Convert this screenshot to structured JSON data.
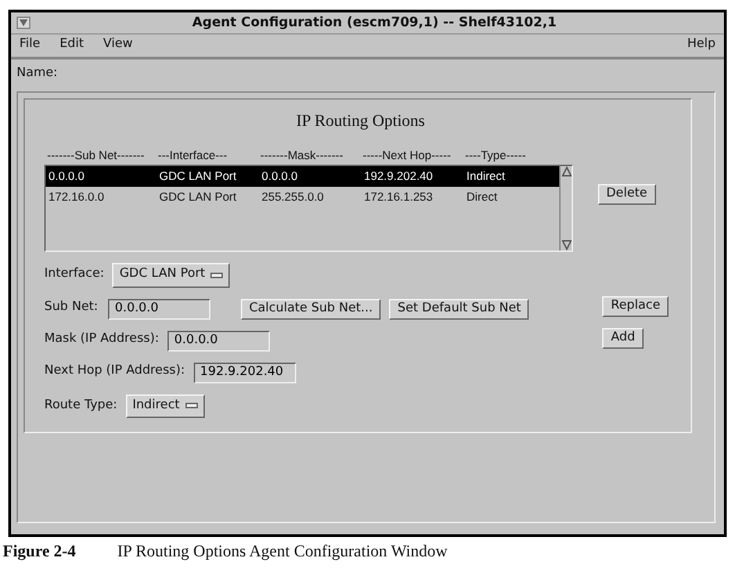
{
  "window": {
    "title": "Agent Configuration (escm709,1) -- Shelf43102,1"
  },
  "menu": [
    "File",
    "Edit",
    "View"
  ],
  "help_menu": "Help",
  "name_label": "Name:",
  "panel": {
    "title": "IP Routing Options",
    "columns": [
      "-------Sub Net-------",
      "---Interface---",
      "-------Mask-------",
      "-----Next Hop-----",
      "----Type-----"
    ],
    "rows": [
      {
        "cells": [
          "0.0.0.0",
          "GDC LAN Port",
          "0.0.0.0",
          "192.9.202.40",
          "Indirect"
        ],
        "selected": true
      },
      {
        "cells": [
          "172.16.0.0",
          "GDC LAN Port",
          "255.255.0.0",
          "172.16.1.253",
          "Direct"
        ],
        "selected": false
      }
    ],
    "delete_button": "Delete",
    "interface": {
      "label": "Interface:",
      "value": "GDC LAN Port"
    },
    "sub_net": {
      "label": "Sub Net:",
      "value": "0.0.0.0"
    },
    "calculate_button": "Calculate Sub Net...",
    "default_button": "Set Default Sub Net",
    "replace_button": "Replace",
    "add_button": "Add",
    "mask": {
      "label": "Mask (IP Address):",
      "value": "0.0.0.0"
    },
    "next_hop": {
      "label": "Next Hop (IP Address):",
      "value": "192.9.202.40"
    },
    "route_type": {
      "label": "Route Type:",
      "value": "Indirect"
    }
  },
  "caption": {
    "number": "Figure 2-4",
    "text": "IP Routing Options Agent Configuration Window"
  }
}
